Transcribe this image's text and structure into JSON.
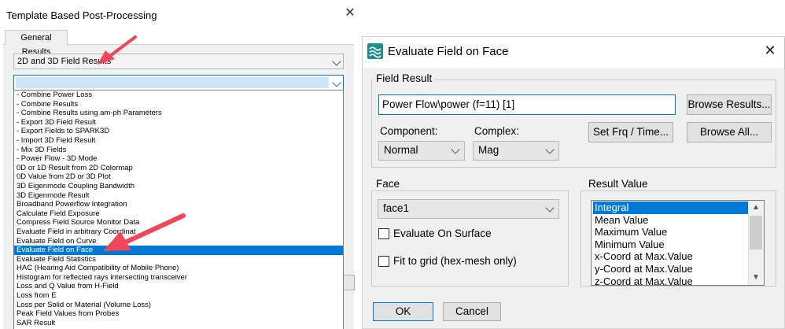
{
  "left_dialog": {
    "title": "Template Based Post-Processing",
    "close_glyph": "✕",
    "tab_label": "General Results",
    "result_type_combo": "2D and 3D Field Results",
    "list_items": [
      "- Combine Power Loss",
      "- Combine Results",
      "- Combine Results using am-ph Parameters",
      "- Export 3D Field Result",
      "- Export Fields to SPARK3D",
      "- Import 3D Field Result",
      "- Mix 3D Fields",
      "- Power Flow - 3D Mode",
      "0D or 1D Result from 2D Colormap",
      "0D Value from 2D or 3D Plot",
      "3D Eigenmode Coupling Bandwidth",
      "3D Eigenmode Result",
      "Broadband Powerflow Integration",
      "Calculate Field Exposure",
      "Compress Field Source Monitor Data",
      "Evaluate Field in arbitrary Coordinat",
      "Evaluate Field on Curve",
      "Evaluate Field on Face",
      "Evaluate Field Statistics",
      "HAC (Hearing Aid Compatibility of Mobile Phone)",
      "Histogram for reflected rays intersecting transceiver",
      "Loss and Q Value from H-Field",
      "Loss from E",
      "Loss per Solid or Material (Volume Loss)",
      "Peak Field Values from Probes",
      "SAR Result"
    ],
    "selected_item": "Evaluate Field on Face",
    "arrow_color": "#f0455a"
  },
  "right_dialog": {
    "title": "Evaluate Field on Face",
    "close_glyph": "✕",
    "field_result_group": "Field Result",
    "field_result_value": "Power Flow\\power (f=11) [1]",
    "browse_results_button": "Browse Results...",
    "set_frq_button": "Set Frq / Time...",
    "browse_all_button": "Browse All...",
    "component_label": "Component:",
    "component_value": "Normal",
    "complex_label": "Complex:",
    "complex_value": "Mag",
    "face_group": "Face",
    "face_value": "face1",
    "evaluate_on_surface_label": "Evaluate On Surface",
    "fit_to_grid_label": "Fit to grid (hex-mesh only)",
    "result_value_group": "Result Value",
    "result_values": [
      "Integral",
      "Mean Value",
      "Maximum Value",
      "Minimum Value",
      "x-Coord at Max.Value",
      "y-Coord at Max.Value",
      "z-Coord at Max.Value"
    ],
    "selected_result": "Integral",
    "ok_button": "OK",
    "cancel_button": "Cancel",
    "scroll_up_glyph": "▲",
    "scroll_down_glyph": "▼"
  },
  "colors": {
    "selection": "#0078d7",
    "app_icon": "#1f8f8a"
  }
}
